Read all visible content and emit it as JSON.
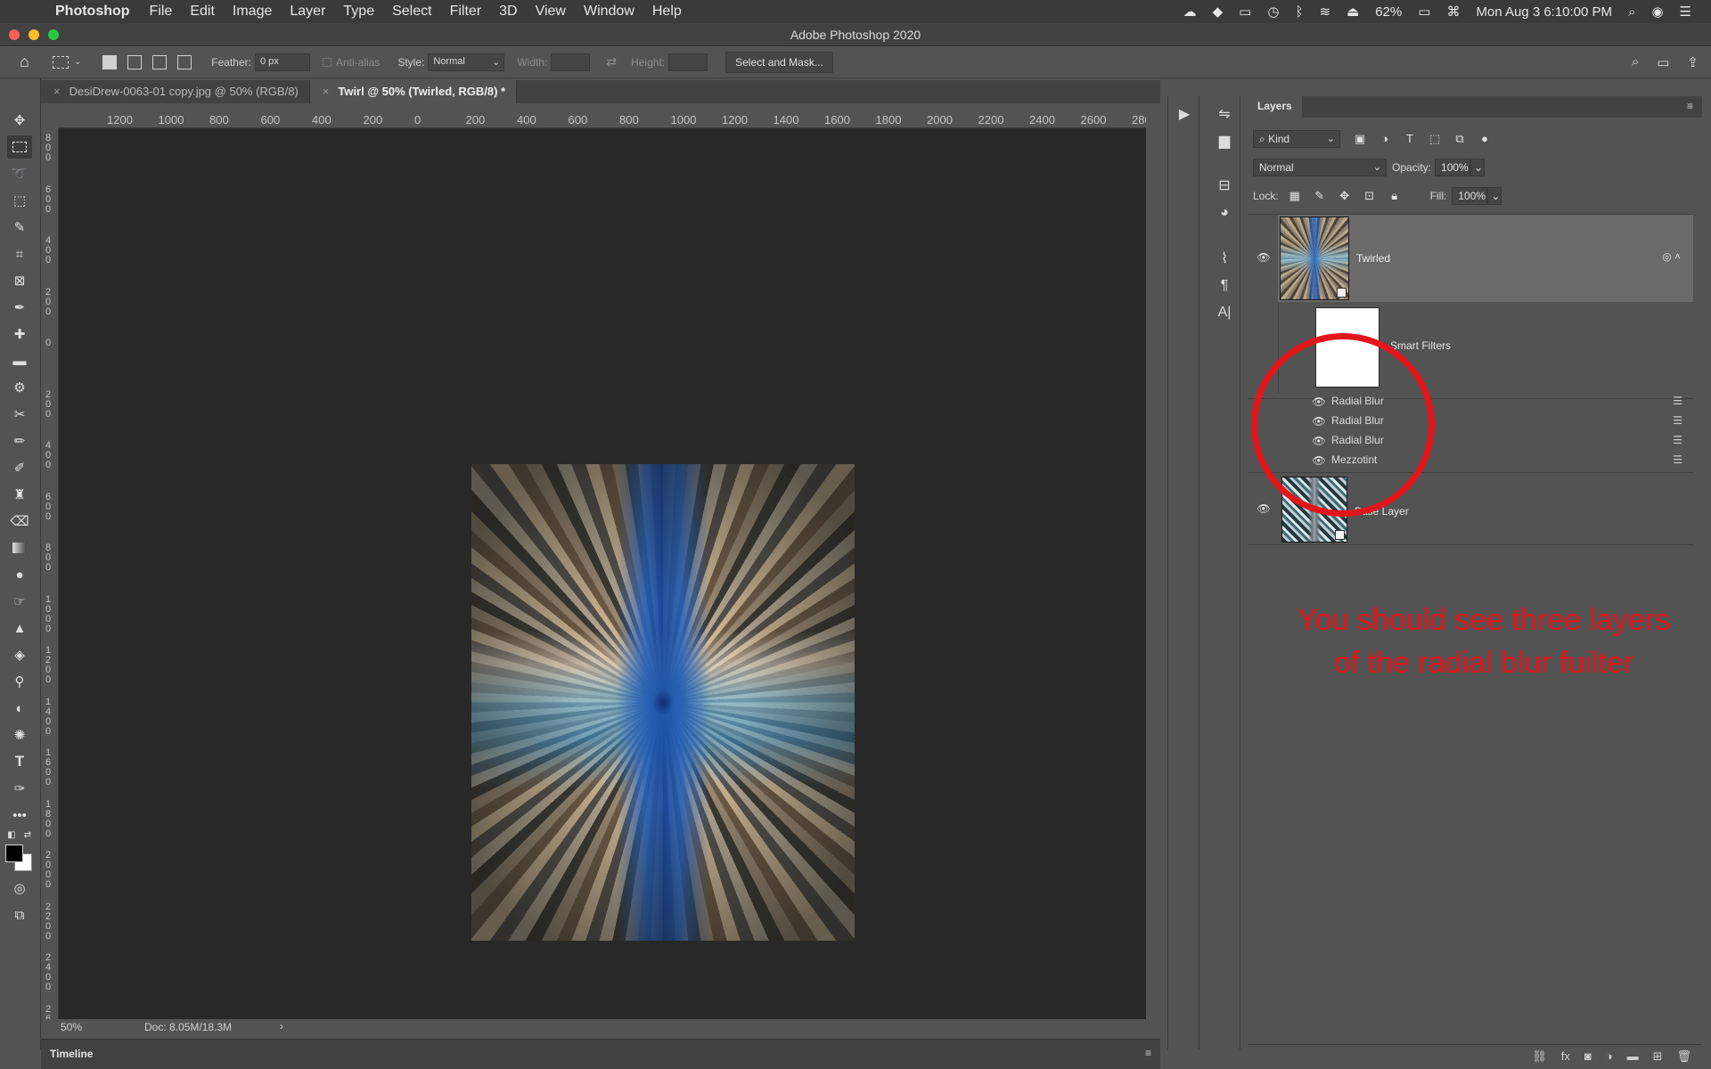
{
  "menubar": {
    "app_name": "Photoshop",
    "items": [
      "File",
      "Edit",
      "Image",
      "Layer",
      "Type",
      "Select",
      "Filter",
      "3D",
      "View",
      "Window",
      "Help"
    ],
    "battery": "62%",
    "datetime": "Mon Aug 3  6:10:00 PM"
  },
  "window": {
    "title": "Adobe Photoshop 2020"
  },
  "options": {
    "feather_label": "Feather:",
    "feather_value": "0 px",
    "antialias_label": "Anti-alias",
    "style_label": "Style:",
    "style_value": "Normal",
    "width_label": "Width:",
    "height_label": "Height:",
    "select_mask_label": "Select and Mask..."
  },
  "tabs": [
    {
      "label": "DesiDrew-0063-01 copy.jpg @ 50% (RGB/8)",
      "active": false
    },
    {
      "label": "Twirl @ 50% (Twirled, RGB/8) *",
      "active": true
    }
  ],
  "ruler": {
    "h_labels": [
      "1200",
      "1000",
      "800",
      "600",
      "400",
      "200",
      "0",
      "200",
      "400",
      "600",
      "800",
      "1000",
      "1200",
      "1400",
      "1600",
      "1800",
      "2000",
      "2200",
      "2400",
      "2600",
      "280"
    ],
    "v_labels": [
      "800",
      "600",
      "400",
      "200",
      "0",
      "200",
      "400",
      "600",
      "800",
      "1000",
      "1200",
      "1400",
      "1600",
      "1800",
      "2000",
      "2200",
      "2400",
      "26"
    ]
  },
  "status": {
    "zoom": "50%",
    "doc": "Doc: 8.05M/18.3M"
  },
  "timeline": {
    "label": "Timeline"
  },
  "layers_panel": {
    "tab_label": "Layers",
    "kind_label": "Kind",
    "blend_mode": "Normal",
    "opacity_label": "Opacity:",
    "opacity_value": "100%",
    "lock_label": "Lock:",
    "fill_label": "Fill:",
    "fill_value": "100%",
    "layers": [
      {
        "name": "Twirled",
        "visible": true,
        "selected": true
      },
      {
        "name": "Base Layer",
        "visible": true,
        "selected": false
      }
    ],
    "smart_filters_label": "Smart Filters",
    "filters": [
      "Radial Blur",
      "Radial Blur",
      "Radial Blur",
      "Mezzotint"
    ]
  },
  "annotation": {
    "line1": "You should see three layers",
    "line2": "of the radial blur fuilter",
    "color": "#e3151b"
  }
}
